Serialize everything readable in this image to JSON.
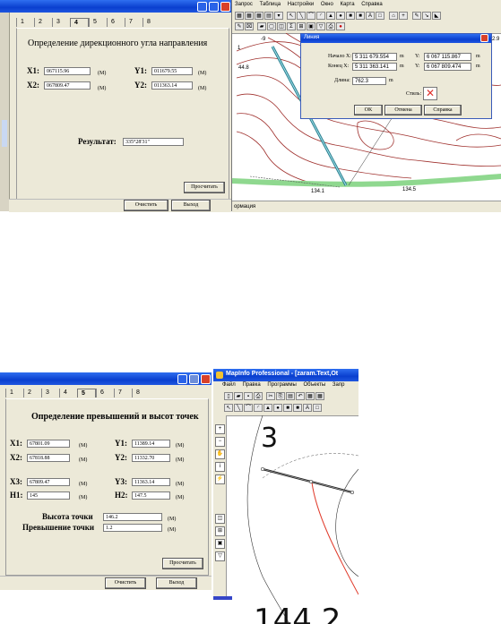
{
  "dialog1": {
    "tabs": [
      "1",
      "2",
      "3",
      "4",
      "5",
      "6",
      "7",
      "8"
    ],
    "title": "Определение дирекционного угла направления",
    "x1_label": "X1:",
    "x1_value": "067115.96",
    "x1_unit": "(М)",
    "y1_label": "Y1:",
    "y1_value": "011679.55",
    "y1_unit": "(М)",
    "x2_label": "X2:",
    "x2_value": "067809.47",
    "x2_unit": "(М)",
    "y2_label": "Y2:",
    "y2_value": "011363.14",
    "y2_unit": "(М)",
    "result_label": "Результат:",
    "result_value": "335°28'31\"",
    "calc_label": "Просчитать",
    "clear_label": "Очистить",
    "exit_label": "Выход"
  },
  "mapwin1": {
    "menu": [
      "Запрос",
      "Таблица",
      "Настройки",
      "Окно",
      "Карта",
      "Справка"
    ],
    "status": "ормация",
    "spot_heights": [
      "44.8",
      "134.1",
      "134.5",
      "-9",
      "1",
      "2.9"
    ],
    "line_dialog": {
      "title": "Линия",
      "start_x_label": "Начало X:",
      "start_x": "5 311 679.554",
      "start_x_unit": "m",
      "start_y_label": "Y:",
      "start_y": "6 067 115.867",
      "start_y_unit": "m",
      "end_x_label": "Конец X:",
      "end_x": "5 311 363.141",
      "end_x_unit": "m",
      "end_y_label": "Y:",
      "end_y": "6 067 809.474",
      "end_y_unit": "m",
      "length_label": "Длина:",
      "length": "762.3",
      "length_unit": "m",
      "style_label": "Стиль:",
      "ok": "OK",
      "cancel": "Отмена",
      "help": "Справка"
    }
  },
  "dialog2": {
    "tabs": [
      "1",
      "2",
      "3",
      "4",
      "5",
      "6",
      "7",
      "8"
    ],
    "title": "Определение превышений и высот точек",
    "x1_label": "X1:",
    "x1_value": "67801.09",
    "x1_unit": "(М)",
    "y1_label": "Y1:",
    "y1_value": "11389.14",
    "y1_unit": "(М)",
    "x2_label": "X2:",
    "x2_value": "67818.88",
    "x2_unit": "(М)",
    "y2_label": "Y2:",
    "y2_value": "11332.70",
    "y2_unit": "(М)",
    "x3_label": "X3:",
    "x3_value": "67809.47",
    "x3_unit": "(М)",
    "y3_label": "Y3:",
    "y3_value": "11363.14",
    "y3_unit": "(М)",
    "h1_label": "H1:",
    "h1_value": "145",
    "h1_unit": "(М)",
    "h2_label": "H2:",
    "h2_value": "147.5",
    "h2_unit": "(М)",
    "height_label": "Высота точки",
    "height_value": "146.2",
    "height_unit": "(М)",
    "excess_label": "Превышение точки",
    "excess_value": "1.2",
    "excess_unit": "(М)",
    "calc_label": "Просчитать",
    "clear_label": "Очистить",
    "exit_label": "Выход"
  },
  "mapwin2": {
    "title": "MapInfo Professional - [zaram.Text,Ot",
    "menu": [
      "Файл",
      "Правка",
      "Программы",
      "Объекты",
      "Запр"
    ],
    "big_label": "3",
    "bottom_label": "144.2"
  }
}
